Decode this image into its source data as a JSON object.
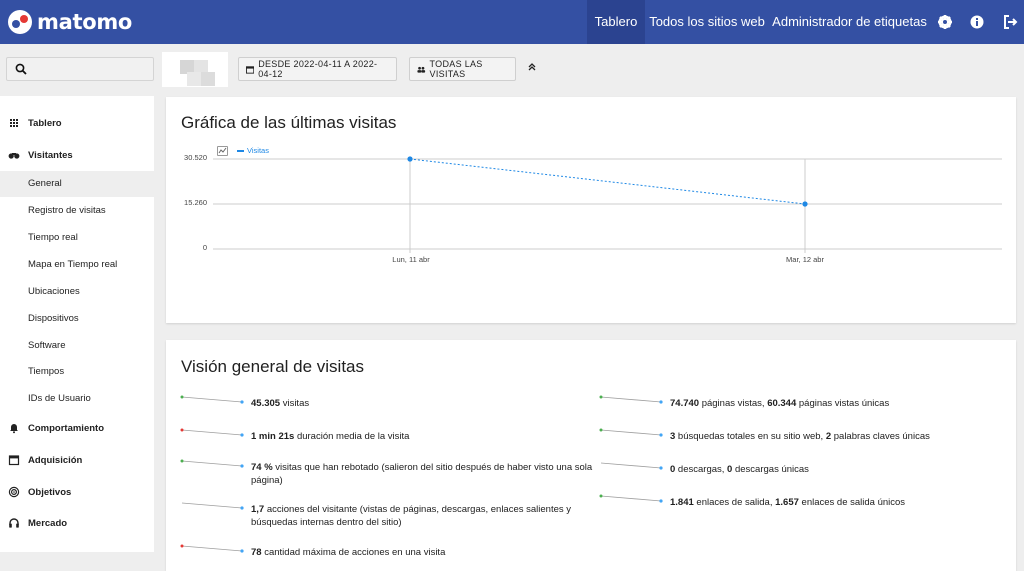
{
  "app": {
    "logo_text": "matomo"
  },
  "topnav": {
    "items": [
      {
        "label": "Tablero",
        "active": true
      },
      {
        "label": "Todos los sitios web"
      },
      {
        "label": "Administrador de etiquetas"
      }
    ],
    "icons": [
      "gear-icon",
      "info-icon",
      "logout-icon"
    ]
  },
  "controls": {
    "search": {
      "placeholder": ""
    },
    "date_button": "DESDE 2022-04-11 A 2022-04-12",
    "segment_button": "TODAS LAS VISITAS"
  },
  "sidebar": {
    "categories": [
      {
        "label": "Tablero",
        "icon": "grid-icon"
      },
      {
        "label": "Visitantes",
        "icon": "binoculars-icon",
        "items": [
          "General",
          "Registro de visitas",
          "Tiempo real",
          "Mapa en Tiempo real",
          "Ubicaciones",
          "Dispositivos",
          "Software",
          "Tiempos",
          "IDs de Usuario"
        ]
      },
      {
        "label": "Comportamiento",
        "icon": "bell-icon"
      },
      {
        "label": "Adquisición",
        "icon": "calendar-icon"
      },
      {
        "label": "Objetivos",
        "icon": "target-icon"
      },
      {
        "label": "Mercado",
        "icon": "headphones-icon"
      }
    ],
    "active_item": "General"
  },
  "graph_card": {
    "title": "Gráfica de las últimas visitas",
    "legend": "Visitas"
  },
  "chart_data": {
    "type": "line",
    "x": [
      "Lun, 11 abr",
      "Mar, 12 abr"
    ],
    "series": [
      {
        "name": "Visitas",
        "values": [
          30520,
          15260
        ],
        "color": "#1e88e5"
      }
    ],
    "yticks": [
      "30.520",
      "15.260",
      "0"
    ],
    "ylim": [
      0,
      30520
    ],
    "grid": true
  },
  "overview": {
    "title": "Visión general de visitas",
    "left": [
      {
        "bold": "45.305",
        "text": " visitas",
        "dot": "#4caf50"
      },
      {
        "bold": "1 min 21s",
        "text": " duración media de la visita",
        "dot": "#e53935"
      },
      {
        "bold": "74 %",
        "text": " visitas que han rebotado (salieron del sitio después de haber visto una sola página)",
        "dot": "#4caf50"
      },
      {
        "bold": "1,7",
        "text": " acciones del visitante (vistas de páginas, descargas, enlaces salientes y búsquedas internas dentro del sitio)",
        "dot": ""
      },
      {
        "bold": "78",
        "text": " cantidad máxima de acciones en una visita",
        "dot": "#e53935"
      }
    ],
    "right": [
      {
        "parts": [
          {
            "b": "74.740"
          },
          {
            "t": " páginas vistas, "
          },
          {
            "b": "60.344"
          },
          {
            "t": " páginas vistas únicas"
          }
        ],
        "dot": "#4caf50"
      },
      {
        "parts": [
          {
            "b": "3"
          },
          {
            "t": " búsquedas totales en su sitio web, "
          },
          {
            "b": "2"
          },
          {
            "t": " palabras claves únicas"
          }
        ],
        "dot": "#4caf50"
      },
      {
        "parts": [
          {
            "b": "0"
          },
          {
            "t": " descargas, "
          },
          {
            "b": "0"
          },
          {
            "t": " descargas únicas"
          }
        ],
        "dot": ""
      },
      {
        "parts": [
          {
            "b": "1.841"
          },
          {
            "t": " enlaces de salida, "
          },
          {
            "b": "1.657"
          },
          {
            "t": " enlaces de salida únicos"
          }
        ],
        "dot": "#4caf50"
      }
    ]
  }
}
